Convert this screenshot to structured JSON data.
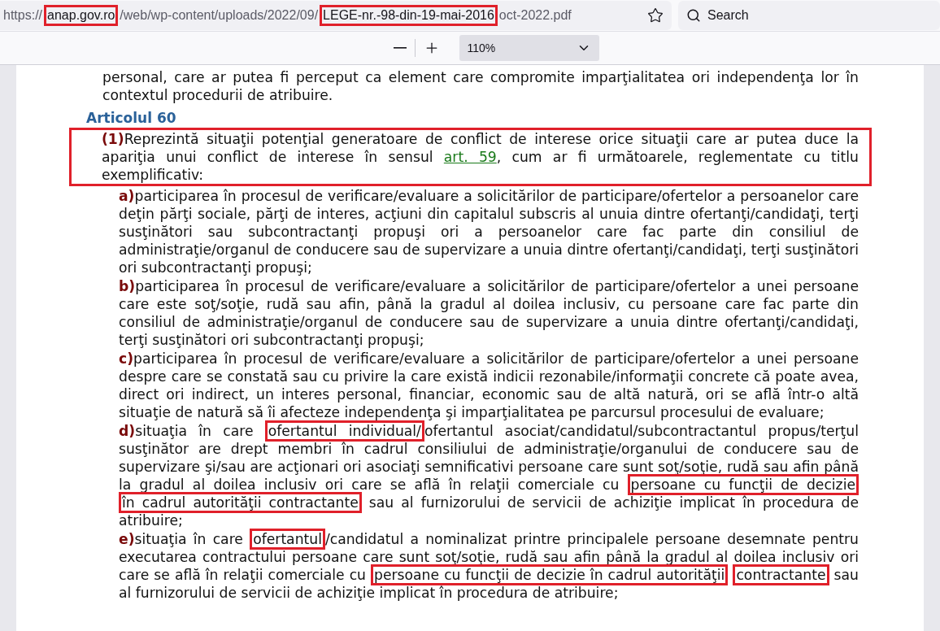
{
  "address_bar": {
    "url": [
      {
        "kind": "plain",
        "text": "https://"
      },
      {
        "kind": "annotated",
        "text": "anap.gov.ro"
      },
      {
        "kind": "plain",
        "text": "/web/wp-content/uploads/2022/09/"
      },
      {
        "kind": "annotated",
        "text": "LEGE-nr.-98-din-19-mai-2016"
      },
      {
        "kind": "plain",
        "text": "oct-2022.pdf"
      }
    ]
  },
  "search": {
    "placeholder": "Search"
  },
  "pdf_toolbar": {
    "zoom": "110%"
  },
  "document": {
    "blocks": [
      {
        "kind": "paragraph",
        "segments": [
          {
            "kind": "text",
            "text": "personal, care ar putea fi perceput ca element care compromite imparţialitatea ori independenţa lor în contextul procedurii de atribuire."
          }
        ]
      },
      {
        "kind": "heading",
        "text": "Articolul 60"
      },
      {
        "kind": "annotated_paragraph",
        "label": "(1)",
        "segments": [
          {
            "kind": "text",
            "text": "Reprezintă situaţii potenţial generatoare de conflict de interese orice situaţii care ar putea duce la apariţia unui conflict de interese în sensul "
          },
          {
            "kind": "link",
            "text": "art. 59"
          },
          {
            "kind": "text",
            "text": ", cum ar fi următoarele, reglementate cu titlu exemplificativ:"
          }
        ]
      },
      {
        "kind": "item",
        "label": "a)",
        "segments": [
          {
            "kind": "text",
            "text": "participarea în procesul de verificare/evaluare a solicitărilor de participare/ofertelor a persoanelor care deţin părţi sociale, părţi de interes, acţiuni din capitalul subscris al unuia dintre ofertanţi/candidaţi, terţi susţinători sau subcontractanţi propuşi ori a persoanelor care fac parte din consiliul de administraţie/organul de conducere sau de supervizare a unuia dintre ofertanţi/candidaţi, terţi susţinători ori subcontractanţi propuşi;"
          }
        ]
      },
      {
        "kind": "item",
        "label": "b)",
        "segments": [
          {
            "kind": "text",
            "text": "participarea în procesul de verificare/evaluare a solicitărilor de participare/ofertelor a unei persoane care este soţ/soţie, rudă sau afin, până la gradul al doilea inclusiv, cu persoane care fac parte din consiliul de administraţie/organul de conducere sau de supervizare a unuia dintre ofertanţi/candidaţi, terţi susţinători ori subcontractanţi propuşi;"
          }
        ]
      },
      {
        "kind": "item",
        "label": "c)",
        "segments": [
          {
            "kind": "text",
            "text": "participarea în procesul de verificare/evaluare a solicitărilor de participare/ofertelor a unei persoane despre care se constată sau cu privire la care există indicii rezonabile/informaţii concrete că poate avea, direct ori indirect, un interes personal, financiar, economic sau de altă natură, ori se află într-o altă situaţie de natură să îi afecteze independenţa şi imparţialitatea pe parcursul procesului de evaluare;"
          }
        ]
      },
      {
        "kind": "item",
        "label": "d)",
        "segments": [
          {
            "kind": "text",
            "text": "situaţia în care "
          },
          {
            "kind": "annotated",
            "text": "ofertantul individual/"
          },
          {
            "kind": "text",
            "text": "ofertantul asociat/candidatul/subcontractantul propus/terţul susţinător are drept membri în cadrul consiliului de administraţie/organului de conducere sau de supervizare şi/sau are acţionari ori asociaţi semnificativi persoane care sunt soţ/soţie, rudă sau afin până la gradul al doilea inclusiv ori care se află în relaţii comerciale cu "
          },
          {
            "kind": "annotated",
            "text": "persoane cu funcţii de decizie"
          },
          {
            "kind": "annotated",
            "text": "în cadrul autorităţii contractante"
          },
          {
            "kind": "text",
            "text": " sau al furnizorului de servicii de achiziţie implicat în procedura de atribuire;"
          }
        ]
      },
      {
        "kind": "item",
        "label": "e)",
        "segments": [
          {
            "kind": "text",
            "text": "situaţia în care "
          },
          {
            "kind": "annotated",
            "text": "ofertantul"
          },
          {
            "kind": "text",
            "text": "/candidatul a nominalizat printre principalele persoane desemnate pentru executarea contractului persoane care sunt soţ/soţie, rudă sau afin până la gradul al doilea inclusiv ori care se află în relaţii comerciale cu "
          },
          {
            "kind": "annotated",
            "text": "persoane cu funcţii de decizie în cadrul autorităţii"
          },
          {
            "kind": "annotated",
            "text": "contractante"
          },
          {
            "kind": "text",
            "text": " sau al furnizorului de servicii de achiziţie implicat în procedura de atribuire;"
          }
        ]
      }
    ]
  }
}
